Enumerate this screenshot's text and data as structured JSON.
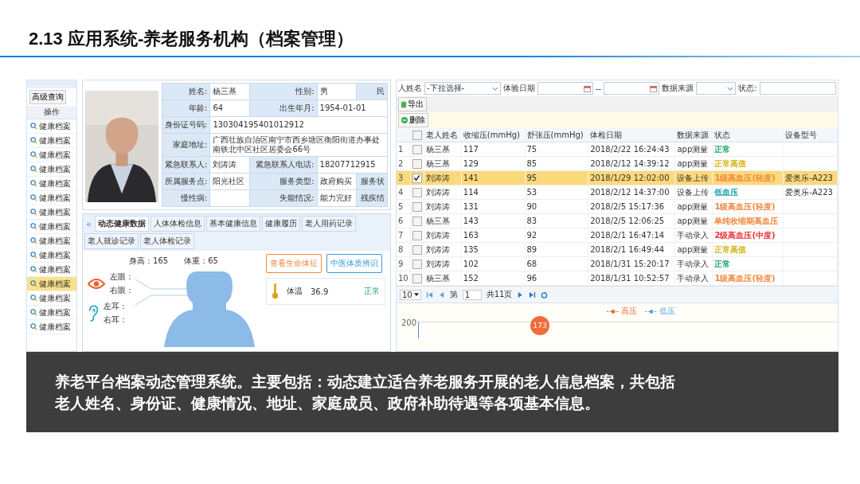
{
  "title": "2.13 应用系统-养老服务机构（档案管理）",
  "list_panel": {
    "query_button": "高级查询",
    "column_header": "操作",
    "items": [
      {
        "label": "健康档案",
        "selected": false
      },
      {
        "label": "健康档案",
        "selected": false
      },
      {
        "label": "健康档案",
        "selected": false
      },
      {
        "label": "健康档案",
        "selected": false
      },
      {
        "label": "健康档案",
        "selected": false
      },
      {
        "label": "健康档案",
        "selected": false
      },
      {
        "label": "健康档案",
        "selected": false
      },
      {
        "label": "健康档案",
        "selected": false
      },
      {
        "label": "健康档案",
        "selected": false
      },
      {
        "label": "健康档案",
        "selected": false
      },
      {
        "label": "健康档案",
        "selected": false
      },
      {
        "label": "健康档案",
        "selected": true
      },
      {
        "label": "健康档案",
        "selected": false
      },
      {
        "label": "健康档案",
        "selected": false
      },
      {
        "label": "健康档案",
        "selected": false
      }
    ]
  },
  "profile": {
    "photo": {
      "kind": "picture"
    },
    "rows": [
      [
        {
          "label": "姓名:",
          "value": "杨三基"
        },
        {
          "label": "性别:",
          "value": "男"
        },
        {
          "label": "民"
        }
      ],
      [
        {
          "label": "年龄:",
          "value": "64"
        },
        {
          "label": "出生年月:",
          "value": "1954-01-01"
        }
      ],
      [
        {
          "label": "身份证号码:",
          "value": "130304195401012912"
        }
      ],
      [
        {
          "label": "家庭地址:",
          "value": "广西壮族自治区南宁市西乡塘区衡阳街道办事处南铁北中区社区居委会66号"
        }
      ],
      [
        {
          "label": "紧急联系人:",
          "value": "刘涛涛"
        },
        {
          "label": "紧急联系人电话:",
          "value": "18207712915"
        }
      ],
      [
        {
          "label": "所属服务点:",
          "value": "阳光社区"
        },
        {
          "label": "服务类型:",
          "value": "政府购买"
        },
        {
          "label": "服务状"
        }
      ],
      [
        {
          "label": "慢性病:"
        },
        {
          "label": "失能情况:",
          "value": "能力完好"
        },
        {
          "label": "残疾情"
        }
      ]
    ]
  },
  "health": {
    "collapse": "«",
    "tabs": [
      {
        "label": "动态健康数据",
        "selected": true
      },
      {
        "label": "人体体检信息",
        "selected": false
      },
      {
        "label": "基本健康信息",
        "selected": false
      },
      {
        "label": "健康履历",
        "selected": false
      },
      {
        "label": "老人用药记录",
        "selected": false
      },
      {
        "label": "老人就诊记录",
        "selected": false
      },
      {
        "label": "老人体检记录",
        "selected": false
      }
    ],
    "height": "身高：165",
    "weight": "体重：65",
    "buttons": [
      {
        "label": "查看生命体征",
        "color": "#f0883e"
      },
      {
        "label": "中医体质辨识",
        "color": "#3a9ad9"
      }
    ],
    "senses": [
      {
        "kind": "eye",
        "lines": [
          "左眼：",
          "右眼："
        ]
      },
      {
        "kind": "ear",
        "lines": [
          "左耳：",
          "右耳："
        ]
      }
    ],
    "vital": {
      "label": "体温",
      "value": "36.9",
      "status": "正常"
    }
  },
  "records": {
    "filters": {
      "name_label": "人姓名",
      "name_select": "-下拉选择-",
      "date_label": "体验日期",
      "range_sep": "--",
      "source_label": "数据来源",
      "status_label": "状态:"
    },
    "actions": [
      {
        "kind": "export",
        "label": "导出"
      },
      {
        "kind": "delete",
        "label": "删除"
      }
    ],
    "all_selected": false,
    "columns": [
      "老人姓名",
      "收缩压(mmHg)",
      "舒张压(mmHg)",
      "体检日期",
      "数据来源",
      "状态",
      "设备型号"
    ],
    "rows": [
      {
        "num": "1",
        "selected": false,
        "name": "杨三基",
        "sys": "117",
        "dia": "75",
        "date": "2018/2/22 16:24:43",
        "source": "app测量",
        "status": "正常",
        "color": "#1aa260",
        "device": ""
      },
      {
        "num": "2",
        "selected": false,
        "name": "杨三基",
        "sys": "129",
        "dia": "85",
        "date": "2018/2/12 14:39:12",
        "source": "app测量",
        "status": "正常高值",
        "color": "#d4b419",
        "device": ""
      },
      {
        "num": "3",
        "selected": true,
        "name": "刘涛涛",
        "sys": "141",
        "dia": "95",
        "date": "2018/1/29 12:02:00",
        "source": "设备上传",
        "status": "1级高血压(轻度)",
        "color": "#f0883e",
        "device": "爱奥乐-A223"
      },
      {
        "num": "4",
        "selected": false,
        "name": "刘涛涛",
        "sys": "114",
        "dia": "53",
        "date": "2018/2/12 14:37:00",
        "source": "设备上传",
        "status": "低血压",
        "color": "#1aa0a8",
        "device": "爱奥乐-A223"
      },
      {
        "num": "5",
        "selected": false,
        "name": "刘涛涛",
        "sys": "131",
        "dia": "90",
        "date": "2018/2/5 15:17:36",
        "source": "app测量",
        "status": "1级高血压(轻度)",
        "color": "#f0883e",
        "device": ""
      },
      {
        "num": "6",
        "selected": false,
        "name": "杨三基",
        "sys": "143",
        "dia": "83",
        "date": "2018/2/5 12:06:25",
        "source": "app测量",
        "status": "单纯收缩期高血压",
        "color": "#f0883e",
        "device": ""
      },
      {
        "num": "7",
        "selected": false,
        "name": "刘涛涛",
        "sys": "163",
        "dia": "92",
        "date": "2018/2/1 16:47:14",
        "source": "手动录入",
        "status": "2级高血压(中度)",
        "color": "#e8343a",
        "device": ""
      },
      {
        "num": "8",
        "selected": false,
        "name": "刘涛涛",
        "sys": "135",
        "dia": "89",
        "date": "2018/2/1 16:49:44",
        "source": "app测量",
        "status": "正常高值",
        "color": "#d4b419",
        "device": ""
      },
      {
        "num": "9",
        "selected": false,
        "name": "刘涛涛",
        "sys": "102",
        "dia": "68",
        "date": "2018/1/31 15:20:17",
        "source": "手动录入",
        "status": "正常",
        "color": "#1aa260",
        "device": ""
      },
      {
        "num": "10",
        "selected": false,
        "name": "杨三基",
        "sys": "152",
        "dia": "96",
        "date": "2018/1/31 10:52:57",
        "source": "手动录入",
        "status": "1级高血压(轻度)",
        "color": "#f0883e",
        "device": ""
      }
    ],
    "pager": {
      "page_size": "10",
      "page_prefix": "第",
      "page": "1",
      "total": "共11页"
    },
    "chart": {
      "legend": [
        {
          "label": "高压",
          "color": "#f26b3a"
        },
        {
          "label": "低压",
          "color": "#5aa9e6"
        }
      ],
      "ytick": "200",
      "point_label": "173"
    }
  },
  "caption": [
    "养老平台档案动态管理系统。主要包括：动态建立适合养老服务开展的老人信息档案，共包括",
    "老人姓名、身份证、健康情况、地址、家庭成员、政府补助待遇等各项基本信息。"
  ]
}
